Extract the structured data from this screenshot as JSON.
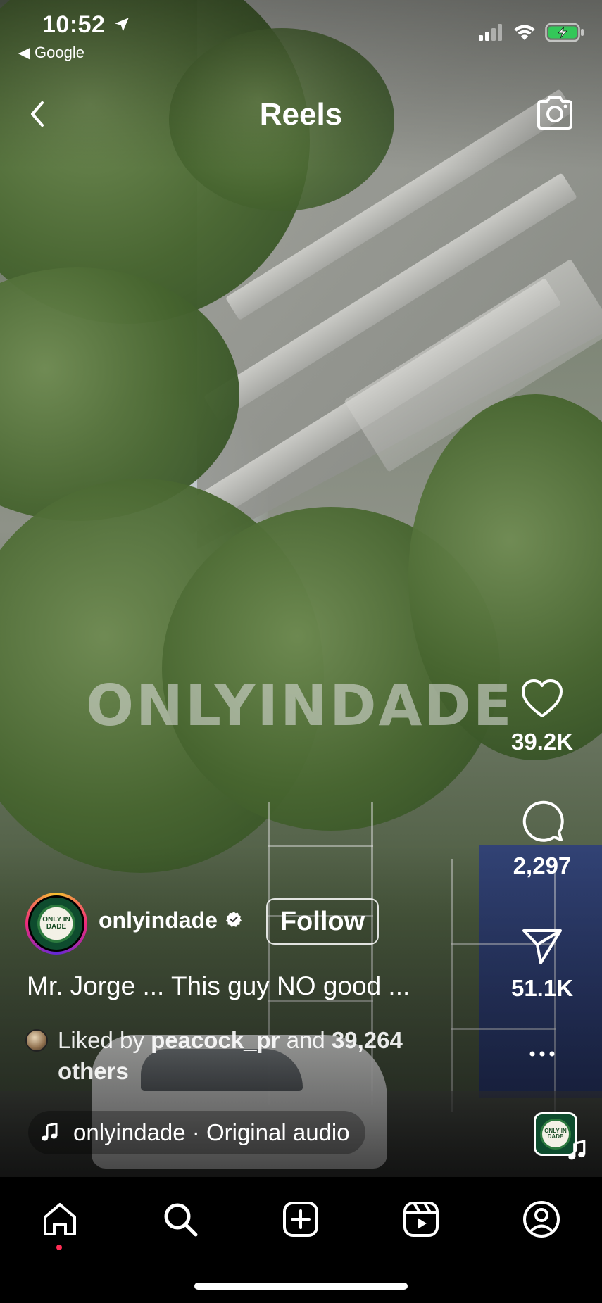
{
  "status_bar": {
    "time": "10:52",
    "back_app": "◀ Google"
  },
  "header": {
    "title": "Reels"
  },
  "video": {
    "watermark": "ONLYINDADE"
  },
  "actions": {
    "likes": "39.2K",
    "comments": "2,297",
    "shares": "51.1K"
  },
  "post": {
    "username": "onlyindade",
    "follow_label": "Follow",
    "caption": "Mr. Jorge ... This guy NO good ...",
    "liked_prefix": "Liked by ",
    "liked_user": "peacock_pr",
    "liked_mid": " and ",
    "liked_count": "39,264",
    "liked_suffix": "others",
    "audio": "onlyindade · Original audio",
    "avatar_text": "ONLY IN DADE"
  },
  "colors": {
    "accent_notification": "#ff2d55",
    "battery_green": "#34c759"
  },
  "icons": {
    "tabs": [
      "home-icon",
      "search-icon",
      "create-icon",
      "reels-icon",
      "profile-icon"
    ]
  }
}
